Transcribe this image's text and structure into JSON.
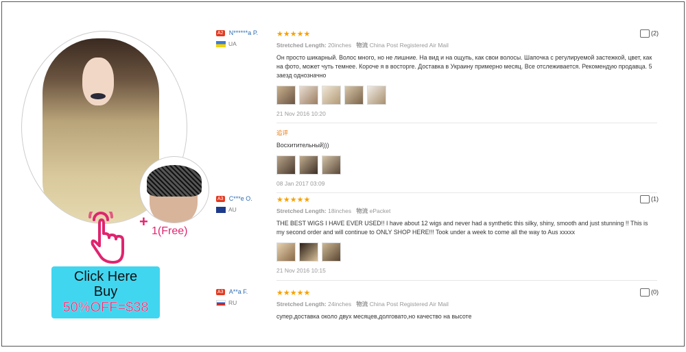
{
  "promo": {
    "free_plus": "+",
    "free_label": "1(Free)",
    "cta_line1": "Click Here",
    "cta_line2": "Buy",
    "cta_line3": "50%OFF=$38"
  },
  "reviews": [
    {
      "badge": "A2",
      "name": "N******a P.",
      "country": "UA",
      "stars": "★★★★★",
      "stretched_label": "Stretched Length:",
      "stretched_value": "20inches",
      "ship_icon_text": "物流",
      "shipping": "China Post Registered Air Mail",
      "text": "Он просто шикарный. Волос много, но не лишние. На вид и на ощупь, как свои волосы. Шапочка с регулируемой застежкой, цвет, как на фото, может чуть темнее. Короче я в восторге. Доставка в Украину примерно месяц. Все отслеживается. Рекомендую продавца. 5 заезд однозначно",
      "date": "21 Nov 2016 10:20",
      "likes": "(2)",
      "additional_label": "追评",
      "additional_text": "Восхитительный)))",
      "additional_date": "08 Jan 2017 03:09"
    },
    {
      "badge": "A3",
      "name": "C***e O.",
      "country": "AU",
      "stars": "★★★★★",
      "stretched_label": "Stretched Length:",
      "stretched_value": "18inches",
      "ship_icon_text": "物流",
      "shipping": "ePacket",
      "text": "THE BEST WIGS I HAVE EVER USED!! I have about 12 wigs and never had a synthetic this silky, shiny, smooth and just stunning !! This is my second order and will continue to ONLY SHOP HERE!!! Took under a week to come all the way to Aus xxxxx",
      "date": "21 Nov 2016 10:15",
      "likes": "(1)"
    },
    {
      "badge": "A3",
      "name": "A**a F.",
      "country": "RU",
      "stars": "★★★★★",
      "stretched_label": "Stretched Length:",
      "stretched_value": "24inches",
      "ship_icon_text": "物流",
      "shipping": "China Post Registered Air Mail",
      "text": "супер.доставка около двух месяцев,долговато,но качество на высоте",
      "likes": "(0)"
    }
  ]
}
